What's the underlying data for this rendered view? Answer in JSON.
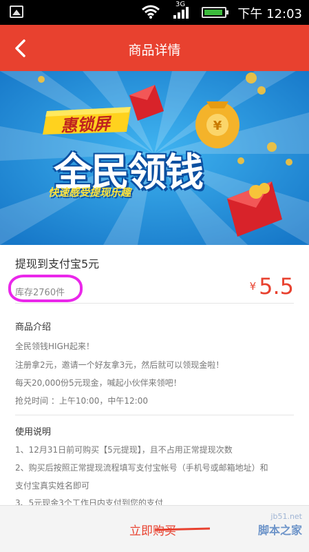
{
  "status_bar": {
    "network": "3G",
    "time": "下午 12:03"
  },
  "header": {
    "title": "商品详情"
  },
  "banner": {
    "brand": "惠锁屏",
    "headline": "全民领钱",
    "tagline": "快速感受提现乐趣"
  },
  "product": {
    "name": "提现到支付宝5元",
    "stock": "库存2760件",
    "currency": "¥",
    "price": "5.5"
  },
  "intro": {
    "title": "商品介绍",
    "lines": [
      "全民领钱HIGH起来！",
      "注册拿2元，邀请一个好友拿3元，然后就可以领现金啦！",
      "每天20,000份5元现金，喊起小伙伴来领吧！",
      "抢兑时间 ：上午10:00，中午12:00"
    ]
  },
  "usage": {
    "title": "使用说明",
    "lines": [
      "1、12月31日前可购买【5元提现】，且不占用正常提现次数",
      "2、购买后按照正常提现流程填写支付宝帐号（手机号或邮箱地址）和",
      "支付宝真实姓名即可",
      "3、5元现金3个工作日内支付到您的支付"
    ]
  },
  "footer": {
    "buy_label": "立即购买"
  },
  "watermark": {
    "site": "jb51.net",
    "name": "脚本之家"
  },
  "colors": {
    "accent": "#e8412f",
    "annotation": "#ea27ea",
    "banner_bg": "#1d8fd8"
  }
}
